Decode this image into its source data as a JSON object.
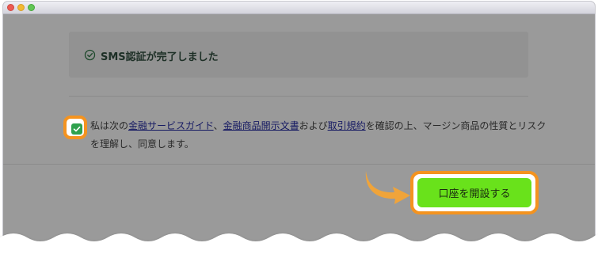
{
  "window": {
    "controls": [
      "close",
      "minimize",
      "zoom"
    ]
  },
  "sms_notice": {
    "icon": "check-circle-icon",
    "text": "SMS認証が完了しました"
  },
  "agreement": {
    "checked": true,
    "prefix": "私は次の",
    "link_guide": "金融サービスガイド",
    "sep1": "、",
    "link_docs": "金融商品開示文書",
    "and": "および",
    "link_terms": "取引規約",
    "suffix": "を確認の上、マージン商品の性質とリスクを理解し、同意します。"
  },
  "cta": {
    "label": "口座を開設する"
  },
  "colors": {
    "highlight": "#f4931f",
    "cta": "#69e21b",
    "checkbox": "#2fa14d"
  }
}
